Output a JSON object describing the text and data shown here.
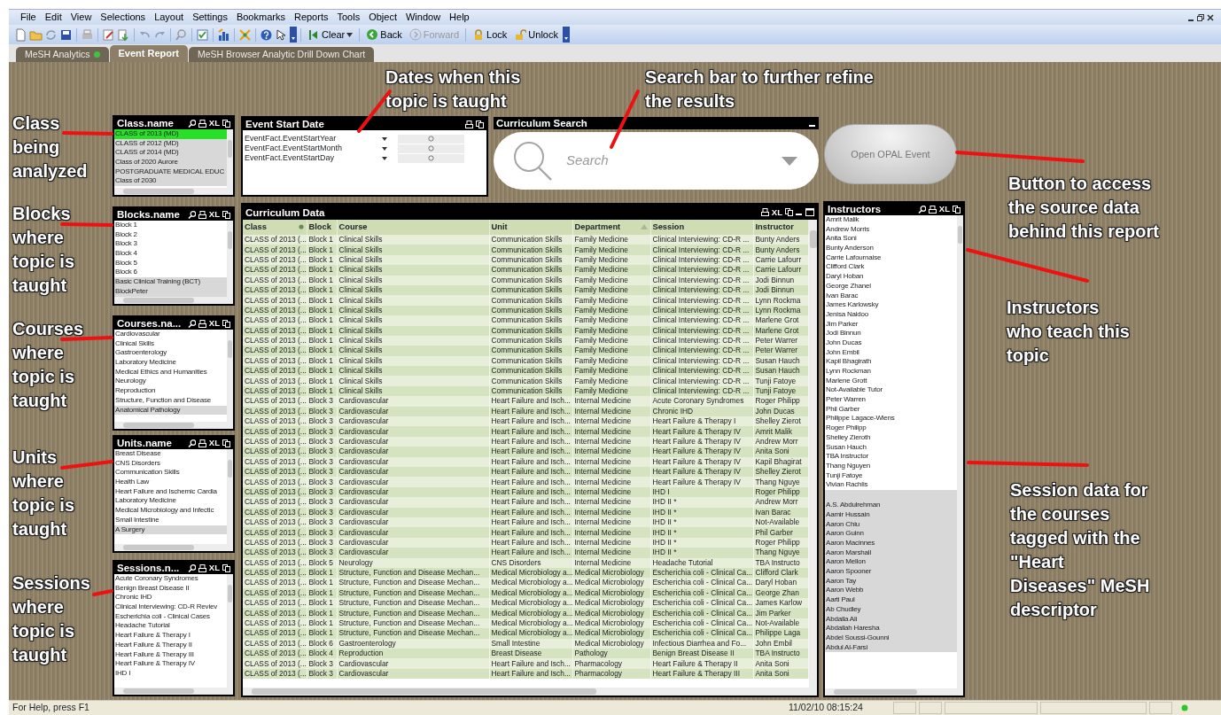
{
  "menu": [
    "File",
    "Edit",
    "View",
    "Selections",
    "Layout",
    "Settings",
    "Bookmarks",
    "Reports",
    "Tools",
    "Object",
    "Window",
    "Help"
  ],
  "toolbar_buttons": [
    {
      "label": "Clear",
      "kind": "clear",
      "disabled": false
    },
    {
      "label": "Back",
      "kind": "back",
      "disabled": false
    },
    {
      "label": "Forward",
      "kind": "forward",
      "disabled": true
    },
    {
      "label": "Lock",
      "kind": "lock",
      "disabled": false
    },
    {
      "label": "Unlock",
      "kind": "unlock",
      "disabled": false
    }
  ],
  "tabs": [
    {
      "label": "MeSH Analytics",
      "selected": false,
      "has_dot": true
    },
    {
      "label": "Event Report",
      "selected": true,
      "has_dot": false
    },
    {
      "label": "MeSH Browser Analytic Drill Down Chart",
      "selected": false,
      "has_dot": false
    }
  ],
  "listboxes": [
    {
      "title": "Class.name",
      "xl_label": "XL",
      "items": [
        {
          "label": "CLASS of 2013 (MD)",
          "selected": true,
          "excluded": false
        },
        {
          "label": "CLASS of 2012 (MD)",
          "selected": false,
          "excluded": true
        },
        {
          "label": "CLASS of 2014 (MD)",
          "selected": false,
          "excluded": true
        },
        {
          "label": "Class of 2020 Aurore",
          "selected": false,
          "excluded": true
        },
        {
          "label": "POSTGRADUATE MEDICAL EDUC",
          "selected": false,
          "excluded": true
        },
        {
          "label": "Class of 2030",
          "selected": false,
          "excluded": true
        }
      ]
    },
    {
      "title": "Blocks.name",
      "xl_label": "XL",
      "items": [
        {
          "label": "Block 1",
          "selected": false,
          "excluded": false
        },
        {
          "label": "Block 2",
          "selected": false,
          "excluded": false
        },
        {
          "label": "Block 3",
          "selected": false,
          "excluded": false
        },
        {
          "label": "Block 4",
          "selected": false,
          "excluded": false
        },
        {
          "label": "Block 5",
          "selected": false,
          "excluded": false
        },
        {
          "label": "Block 6",
          "selected": false,
          "excluded": false
        },
        {
          "label": "Basic Clinical Training (BCT)",
          "selected": false,
          "excluded": true
        },
        {
          "label": "BlockPeter",
          "selected": false,
          "excluded": true
        }
      ]
    },
    {
      "title": "Courses.na...",
      "xl_label": "XL",
      "items": [
        {
          "label": "Cardiovascular",
          "selected": false,
          "excluded": false
        },
        {
          "label": "Clinical Skills",
          "selected": false,
          "excluded": false
        },
        {
          "label": "Gastroenterology",
          "selected": false,
          "excluded": false
        },
        {
          "label": "Laboratory Medicine",
          "selected": false,
          "excluded": false
        },
        {
          "label": "Medical Ethics and Humanities",
          "selected": false,
          "excluded": false
        },
        {
          "label": "Neurology",
          "selected": false,
          "excluded": false
        },
        {
          "label": "Reproduction",
          "selected": false,
          "excluded": false
        },
        {
          "label": "Structure, Function and Disease",
          "selected": false,
          "excluded": false
        },
        {
          "label": "Anatomical Pathology",
          "selected": false,
          "excluded": true
        }
      ]
    },
    {
      "title": "Units.name",
      "xl_label": "XL",
      "items": [
        {
          "label": "Breast Disease",
          "selected": false,
          "excluded": false
        },
        {
          "label": "CNS Disorders",
          "selected": false,
          "excluded": false
        },
        {
          "label": "Communication Skills",
          "selected": false,
          "excluded": false
        },
        {
          "label": "Health Law",
          "selected": false,
          "excluded": false
        },
        {
          "label": "Heart Failure and Ischemic Cardia",
          "selected": false,
          "excluded": false
        },
        {
          "label": "Laboratory Medicine",
          "selected": false,
          "excluded": false
        },
        {
          "label": "Medical Microbiology and Infectic",
          "selected": false,
          "excluded": false
        },
        {
          "label": "Small Intestine",
          "selected": false,
          "excluded": false
        },
        {
          "label": "A Surgery",
          "selected": false,
          "excluded": true
        }
      ]
    },
    {
      "title": "Sessions.n...",
      "xl_label": "XL",
      "items": [
        {
          "label": "Acute Coronary Syndromes",
          "selected": false,
          "excluded": false
        },
        {
          "label": "Benign Breast Disease II",
          "selected": false,
          "excluded": false
        },
        {
          "label": "Chronic IHD",
          "selected": false,
          "excluded": false
        },
        {
          "label": "Clinical Interviewing: CD-R Reviev",
          "selected": false,
          "excluded": false
        },
        {
          "label": "Escherichia coli - Clinical Cases",
          "selected": false,
          "excluded": false
        },
        {
          "label": "Headache Tutorial",
          "selected": false,
          "excluded": false
        },
        {
          "label": "Heart Failure & Therapy I",
          "selected": false,
          "excluded": false
        },
        {
          "label": "Heart Failure & Therapy II",
          "selected": false,
          "excluded": false
        },
        {
          "label": "Heart Failure & Therapy III",
          "selected": false,
          "excluded": false
        },
        {
          "label": "Heart Failure & Therapy IV",
          "selected": false,
          "excluded": false
        },
        {
          "label": "IHD I",
          "selected": false,
          "excluded": false
        }
      ]
    }
  ],
  "event_start_date": {
    "title": "Event Start Date",
    "fields": [
      {
        "label": "EventFact.EventStartYear"
      },
      {
        "label": "EventFact.EventStartMonth"
      },
      {
        "label": "EventFact.EventStartDay"
      }
    ]
  },
  "curriculum_search": {
    "title": "Curriculum Search",
    "placeholder": "Search"
  },
  "open_button": {
    "label": "Open OPAL Event"
  },
  "curriculum_data": {
    "title": "Curriculum Data",
    "xl_label": "XL",
    "columns": [
      {
        "label": "Class",
        "has_dot": true,
        "sort_ascending": false
      },
      {
        "label": "Block",
        "has_dot": false,
        "sort_ascending": false
      },
      {
        "label": "Course",
        "has_dot": false,
        "sort_ascending": false
      },
      {
        "label": "Unit",
        "has_dot": false,
        "sort_ascending": false
      },
      {
        "label": "Department",
        "has_dot": false,
        "sort_ascending": true
      },
      {
        "label": "Session",
        "has_dot": false,
        "sort_ascending": false
      },
      {
        "label": "Instructor",
        "has_dot": false,
        "sort_ascending": false
      }
    ],
    "rows": [
      [
        "CLASS of 2013 (...",
        "Block 1",
        "Clinical Skills",
        "Communication Skills",
        "Family Medicine",
        "Clinical Interviewing: CD-R ...",
        "Bunty Anders"
      ],
      [
        "CLASS of 2013 (...",
        "Block 1",
        "Clinical Skills",
        "Communication Skills",
        "Family Medicine",
        "Clinical Interviewing: CD-R ...",
        "Bunty Anders"
      ],
      [
        "CLASS of 2013 (...",
        "Block 1",
        "Clinical Skills",
        "Communication Skills",
        "Family Medicine",
        "Clinical Interviewing: CD-R ...",
        "Carrie Lafourr"
      ],
      [
        "CLASS of 2013 (...",
        "Block 1",
        "Clinical Skills",
        "Communication Skills",
        "Family Medicine",
        "Clinical Interviewing: CD-R ...",
        "Carrie Lafourr"
      ],
      [
        "CLASS of 2013 (...",
        "Block 1",
        "Clinical Skills",
        "Communication Skills",
        "Family Medicine",
        "Clinical Interviewing: CD-R ...",
        "Jodi Binnun"
      ],
      [
        "CLASS of 2013 (...",
        "Block 1",
        "Clinical Skills",
        "Communication Skills",
        "Family Medicine",
        "Clinical Interviewing: CD-R ...",
        "Jodi Binnun"
      ],
      [
        "CLASS of 2013 (...",
        "Block 1",
        "Clinical Skills",
        "Communication Skills",
        "Family Medicine",
        "Clinical Interviewing: CD-R ...",
        "Lynn Rockma"
      ],
      [
        "CLASS of 2013 (...",
        "Block 1",
        "Clinical Skills",
        "Communication Skills",
        "Family Medicine",
        "Clinical Interviewing: CD-R ...",
        "Lynn Rockma"
      ],
      [
        "CLASS of 2013 (...",
        "Block 1",
        "Clinical Skills",
        "Communication Skills",
        "Family Medicine",
        "Clinical Interviewing: CD-R ...",
        "Marlene Grot"
      ],
      [
        "CLASS of 2013 (...",
        "Block 1",
        "Clinical Skills",
        "Communication Skills",
        "Family Medicine",
        "Clinical Interviewing: CD-R ...",
        "Marlene Grot"
      ],
      [
        "CLASS of 2013 (...",
        "Block 1",
        "Clinical Skills",
        "Communication Skills",
        "Family Medicine",
        "Clinical Interviewing: CD-R ...",
        "Peter Warrer"
      ],
      [
        "CLASS of 2013 (...",
        "Block 1",
        "Clinical Skills",
        "Communication Skills",
        "Family Medicine",
        "Clinical Interviewing: CD-R ...",
        "Peter Warrer"
      ],
      [
        "CLASS of 2013 (...",
        "Block 1",
        "Clinical Skills",
        "Communication Skills",
        "Family Medicine",
        "Clinical Interviewing: CD-R ...",
        "Susan Hauch"
      ],
      [
        "CLASS of 2013 (...",
        "Block 1",
        "Clinical Skills",
        "Communication Skills",
        "Family Medicine",
        "Clinical Interviewing: CD-R ...",
        "Susan Hauch"
      ],
      [
        "CLASS of 2013 (...",
        "Block 1",
        "Clinical Skills",
        "Communication Skills",
        "Family Medicine",
        "Clinical Interviewing: CD-R ...",
        "Tunji Fatoye"
      ],
      [
        "CLASS of 2013 (...",
        "Block 1",
        "Clinical Skills",
        "Communication Skills",
        "Family Medicine",
        "Clinical Interviewing: CD-R ...",
        "Tunji Fatoye"
      ],
      [
        "CLASS of 2013 (...",
        "Block 3",
        "Cardiovascular",
        "Heart Failure and Isch...",
        "Internal Medicine",
        "Acute Coronary Syndromes",
        "Roger Philipp"
      ],
      [
        "CLASS of 2013 (...",
        "Block 3",
        "Cardiovascular",
        "Heart Failure and Isch...",
        "Internal Medicine",
        "Chronic IHD",
        "John Ducas"
      ],
      [
        "CLASS of 2013 (...",
        "Block 3",
        "Cardiovascular",
        "Heart Failure and Isch...",
        "Internal Medicine",
        "Heart Failure & Therapy I",
        "Shelley Zierot"
      ],
      [
        "CLASS of 2013 (...",
        "Block 3",
        "Cardiovascular",
        "Heart Failure and Isch...",
        "Internal Medicine",
        "Heart Failure & Therapy IV",
        "Amrit Malik"
      ],
      [
        "CLASS of 2013 (...",
        "Block 3",
        "Cardiovascular",
        "Heart Failure and Isch...",
        "Internal Medicine",
        "Heart Failure & Therapy IV",
        "Andrew Morr"
      ],
      [
        "CLASS of 2013 (...",
        "Block 3",
        "Cardiovascular",
        "Heart Failure and Isch...",
        "Internal Medicine",
        "Heart Failure & Therapy IV",
        "Anita Soni"
      ],
      [
        "CLASS of 2013 (...",
        "Block 3",
        "Cardiovascular",
        "Heart Failure and Isch...",
        "Internal Medicine",
        "Heart Failure & Therapy IV",
        "Kapil Bhagirat"
      ],
      [
        "CLASS of 2013 (...",
        "Block 3",
        "Cardiovascular",
        "Heart Failure and Isch...",
        "Internal Medicine",
        "Heart Failure & Therapy IV",
        "Shelley Zierot"
      ],
      [
        "CLASS of 2013 (...",
        "Block 3",
        "Cardiovascular",
        "Heart Failure and Isch...",
        "Internal Medicine",
        "Heart Failure & Therapy IV",
        "Thang Nguye"
      ],
      [
        "CLASS of 2013 (...",
        "Block 3",
        "Cardiovascular",
        "Heart Failure and Isch...",
        "Internal Medicine",
        "IHD I",
        "Roger Philipp"
      ],
      [
        "CLASS of 2013 (...",
        "Block 3",
        "Cardiovascular",
        "Heart Failure and Isch...",
        "Internal Medicine",
        "IHD II *",
        "Andrew Morr"
      ],
      [
        "CLASS of 2013 (...",
        "Block 3",
        "Cardiovascular",
        "Heart Failure and Isch...",
        "Internal Medicine",
        "IHD II *",
        "Ivan Barac"
      ],
      [
        "CLASS of 2013 (...",
        "Block 3",
        "Cardiovascular",
        "Heart Failure and Isch...",
        "Internal Medicine",
        "IHD II *",
        "Not-Available"
      ],
      [
        "CLASS of 2013 (...",
        "Block 3",
        "Cardiovascular",
        "Heart Failure and Isch...",
        "Internal Medicine",
        "IHD II *",
        "Phil Garber"
      ],
      [
        "CLASS of 2013 (...",
        "Block 3",
        "Cardiovascular",
        "Heart Failure and Isch...",
        "Internal Medicine",
        "IHD II *",
        "Roger Philipp"
      ],
      [
        "CLASS of 2013 (...",
        "Block 3",
        "Cardiovascular",
        "Heart Failure and Isch...",
        "Internal Medicine",
        "IHD II *",
        "Thang Nguye"
      ],
      [
        "CLASS of 2013 (...",
        "Block 5",
        "Neurology",
        "CNS Disorders",
        "Internal Medicine",
        "Headache Tutorial",
        "TBA Instructo"
      ],
      [
        "CLASS of 2013 (...",
        "Block 1",
        "Structure, Function and Disease Mechan...",
        "Medical Microbiology a...",
        "Medical Microbiology",
        "Escherichia coli - Clinical Ca...",
        "Clifford Clark"
      ],
      [
        "CLASS of 2013 (...",
        "Block 1",
        "Structure, Function and Disease Mechan...",
        "Medical Microbiology a...",
        "Medical Microbiology",
        "Escherichia coli - Clinical Ca...",
        "Daryl Hoban"
      ],
      [
        "CLASS of 2013 (...",
        "Block 1",
        "Structure, Function and Disease Mechan...",
        "Medical Microbiology a...",
        "Medical Microbiology",
        "Escherichia coli - Clinical Ca...",
        "George Zhan"
      ],
      [
        "CLASS of 2013 (...",
        "Block 1",
        "Structure, Function and Disease Mechan...",
        "Medical Microbiology a...",
        "Medical Microbiology",
        "Escherichia coli - Clinical Ca...",
        "James Karlow"
      ],
      [
        "CLASS of 2013 (...",
        "Block 1",
        "Structure, Function and Disease Mechan...",
        "Medical Microbiology a...",
        "Medical Microbiology",
        "Escherichia coli - Clinical Ca...",
        "Jim Parker"
      ],
      [
        "CLASS of 2013 (...",
        "Block 1",
        "Structure, Function and Disease Mechan...",
        "Medical Microbiology a...",
        "Medical Microbiology",
        "Escherichia coli - Clinical Ca...",
        "Not-Available"
      ],
      [
        "CLASS of 2013 (...",
        "Block 1",
        "Structure, Function and Disease Mechan...",
        "Medical Microbiology a...",
        "Medical Microbiology",
        "Escherichia coli - Clinical Ca...",
        "Philippe Laga"
      ],
      [
        "CLASS of 2013 (...",
        "Block 6",
        "Gastroenterology",
        "Small Intestine",
        "Medical Microbiology",
        "Infectious Diarrhea and Fo...",
        "John Embil"
      ],
      [
        "CLASS of 2013 (...",
        "Block 4",
        "Reproduction",
        "Breast Disease",
        "Pathology",
        "Benign Breast Disease II",
        "TBA Instructo"
      ],
      [
        "CLASS of 2013 (...",
        "Block 3",
        "Cardiovascular",
        "Heart Failure and Isch...",
        "Pharmacology",
        "Heart Failure & Therapy II",
        "Anita Soni"
      ],
      [
        "CLASS of 2013 (...",
        "Block 3",
        "Cardiovascular",
        "Heart Failure and Isch...",
        "Pharmacology",
        "Heart Failure & Therapy III",
        "Anita Soni"
      ]
    ]
  },
  "instructors": {
    "title": "Instructors",
    "xl_label": "XL",
    "items": [
      {
        "label": "Amrit Malik",
        "excluded": false
      },
      {
        "label": "Andrew Morris",
        "excluded": false
      },
      {
        "label": "Anita Soni",
        "excluded": false
      },
      {
        "label": "Bunty Anderson",
        "excluded": false
      },
      {
        "label": "Carrie Lafournaise",
        "excluded": false
      },
      {
        "label": "Clifford Clark",
        "excluded": false
      },
      {
        "label": "Daryl Hoban",
        "excluded": false
      },
      {
        "label": "George Zhanel",
        "excluded": false
      },
      {
        "label": "Ivan Barac",
        "excluded": false
      },
      {
        "label": "James Karlowsky",
        "excluded": false
      },
      {
        "label": "Jenisa Naidoo",
        "excluded": false
      },
      {
        "label": "Jim Parker",
        "excluded": false
      },
      {
        "label": "Jodi Binnun",
        "excluded": false
      },
      {
        "label": "John Ducas",
        "excluded": false
      },
      {
        "label": "John Embil",
        "excluded": false
      },
      {
        "label": "Kapil Bhagirath",
        "excluded": false
      },
      {
        "label": "Lynn Rockman",
        "excluded": false
      },
      {
        "label": "Marlene Grott",
        "excluded": false
      },
      {
        "label": "Not-Available Tutor",
        "excluded": false
      },
      {
        "label": "Peter Warren",
        "excluded": false
      },
      {
        "label": "Phil Garber",
        "excluded": false
      },
      {
        "label": "Philippe Lagace-Wiens",
        "excluded": false
      },
      {
        "label": "Roger Philipp",
        "excluded": false
      },
      {
        "label": "Shelley Zieroth",
        "excluded": false
      },
      {
        "label": "Susan Hauch",
        "excluded": false
      },
      {
        "label": "TBA Instructor",
        "excluded": false
      },
      {
        "label": "Thang Nguyen",
        "excluded": false
      },
      {
        "label": "Tunji Fatoye",
        "excluded": false
      },
      {
        "label": "Vivian Rachlis",
        "excluded": false
      },
      {
        "label": "A.S. Abdulrehman",
        "excluded": true
      },
      {
        "label": "Aamir Hussain",
        "excluded": true
      },
      {
        "label": "Aaron Chiu",
        "excluded": true
      },
      {
        "label": "Aaron Guinn",
        "excluded": true
      },
      {
        "label": "Aaron Macinnes",
        "excluded": true
      },
      {
        "label": "Aaron Marshall",
        "excluded": true
      },
      {
        "label": "Aaron Mellon",
        "excluded": true
      },
      {
        "label": "Aaron Spooner",
        "excluded": true
      },
      {
        "label": "Aaron Tay",
        "excluded": true
      },
      {
        "label": "Aaron Webb",
        "excluded": true
      },
      {
        "label": "Aarti Paul",
        "excluded": true
      },
      {
        "label": "Ab Chudley",
        "excluded": true
      },
      {
        "label": "Abdalla Ali",
        "excluded": true
      },
      {
        "label": "Abdallah Haresha",
        "excluded": true
      },
      {
        "label": "Abdel Soussi-Gounni",
        "excluded": true
      },
      {
        "label": "Abdul Al-Farsi",
        "excluded": true
      }
    ]
  },
  "annotations": [
    {
      "text": "Class\nbeing\nanalyzed"
    },
    {
      "text": "Blocks\nwhere\ntopic is\ntaught"
    },
    {
      "text": "Courses\nwhere\ntopic is\ntaught"
    },
    {
      "text": "Units\nwhere\ntopic is\ntaught"
    },
    {
      "text": "Sessions\nwhere\ntopic is\ntaught"
    },
    {
      "text": "Dates when this\ntopic is taught"
    },
    {
      "text": "Search bar to further refine\nthe results"
    },
    {
      "text": "Button to access\nthe source data\nbehind this report"
    },
    {
      "text": "Instructors\nwho teach this\ntopic"
    },
    {
      "text": "Session data for\nthe courses\ntagged with the\n\"Heart\nDiseases\" MeSH\ndescriptor"
    }
  ],
  "status_bar": {
    "help": "For Help, press F1",
    "datetime": "11/02/10 08:15:24"
  }
}
